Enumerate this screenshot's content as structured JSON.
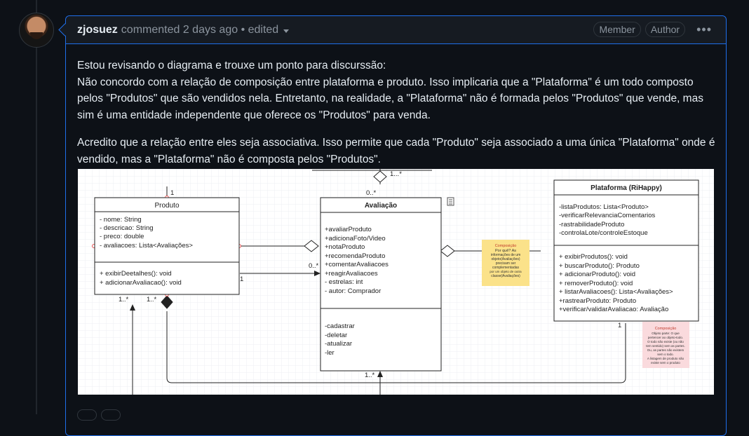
{
  "comment": {
    "author": "zjosuez",
    "meta": "commented 2 days ago • edited",
    "badges": [
      "Member",
      "Author"
    ],
    "more_label": "•••",
    "paragraphs": [
      "Estou revisando o diagrama e trouxe um ponto para discurssão:",
      "Não concordo com a relação de composição entre plataforma e produto. Isso implicaria que a \"Plataforma\" é um todo composto pelos \"Produtos\" que são vendidos nela. Entretanto, na realidade, a \"Plataforma\" não é formada pelos \"Produtos\" que vende, mas sim é uma entidade independente que oferece os \"Produtos\" para venda.",
      "Acredito que a relação entre eles seja associativa. Isso permite que cada \"Produto\" seja associado a uma única \"Plataforma\" onde é vendido, mas a \"Plataforma\" não é composta pelos \"Produtos\"."
    ]
  },
  "diagram": {
    "produto": {
      "title": "Produto",
      "attributes": [
        "- nome: String",
        "- descricao: String",
        "- preco: double",
        "- avaliacoes: Lista<Avaliações>"
      ],
      "methods": [
        "+ exibirDeetalhes(): void",
        "+ adicionarAvaliacao(): void"
      ]
    },
    "avaliacao": {
      "title": "Avaliação",
      "attributes": [
        "+avaliarProduto",
        "+adicionaFoto/Video",
        "+notaProduto",
        "+recomendaProduto",
        "+comentarAvaliacoes",
        "+reagirAvaliacoes",
        "- estrelas: int",
        "- autor: Comprador"
      ],
      "methods": [
        "-cadastrar",
        "-deletar",
        "-atualizar",
        "-ler"
      ]
    },
    "plataforma": {
      "title": "Plataforma (RiHappy)",
      "attributes": [
        "-listaProdutos: Lista<Produto>",
        "-verificarRelevanciaComentarios",
        "-rastrabilidadeProduto",
        "-controlaLote/controleEstoque"
      ],
      "methods": [
        "+ exibirProdutos(): void",
        "+ buscarProduto(): Produto",
        "+ adicionarProduto(): void",
        "+ removerProduto(): void",
        "+ listarAvaliacoes(): Lista<Avaliações>",
        "+rastrearProduto: Produto",
        "+verificar/validarAvaliacao: Avaliação"
      ]
    },
    "multiplicities": {
      "top_one": "1",
      "top_many": "1...*",
      "aval_top": "0..*",
      "aval_left": "0..*",
      "produto_right": "1",
      "produto_bottom_a": "1..*",
      "produto_bottom_b": "1..*",
      "plataforma_bottom": "1",
      "aval_bottom": "1..*"
    },
    "note_yellow": {
      "title": "Composição",
      "lines": [
        "Por quê? As",
        "informações de um",
        "objeto(Avaliações)",
        "precisam ser",
        "complementadas",
        "por um objeto de outra",
        "classe(Avaliações)"
      ],
      "color": "#fbe28a"
    },
    "note_pink": {
      "title": "Composição",
      "lines": [
        "Objeto parte: O que",
        "pertencer ao objeto-todo.",
        "O todo não existe (ou não",
        "tem sentido) sem as partes.",
        "Ou, as partes não existem",
        "sem o todo.",
        "A listagem de produto não",
        "existe sem o produto"
      ],
      "color": "#fadadd"
    }
  }
}
